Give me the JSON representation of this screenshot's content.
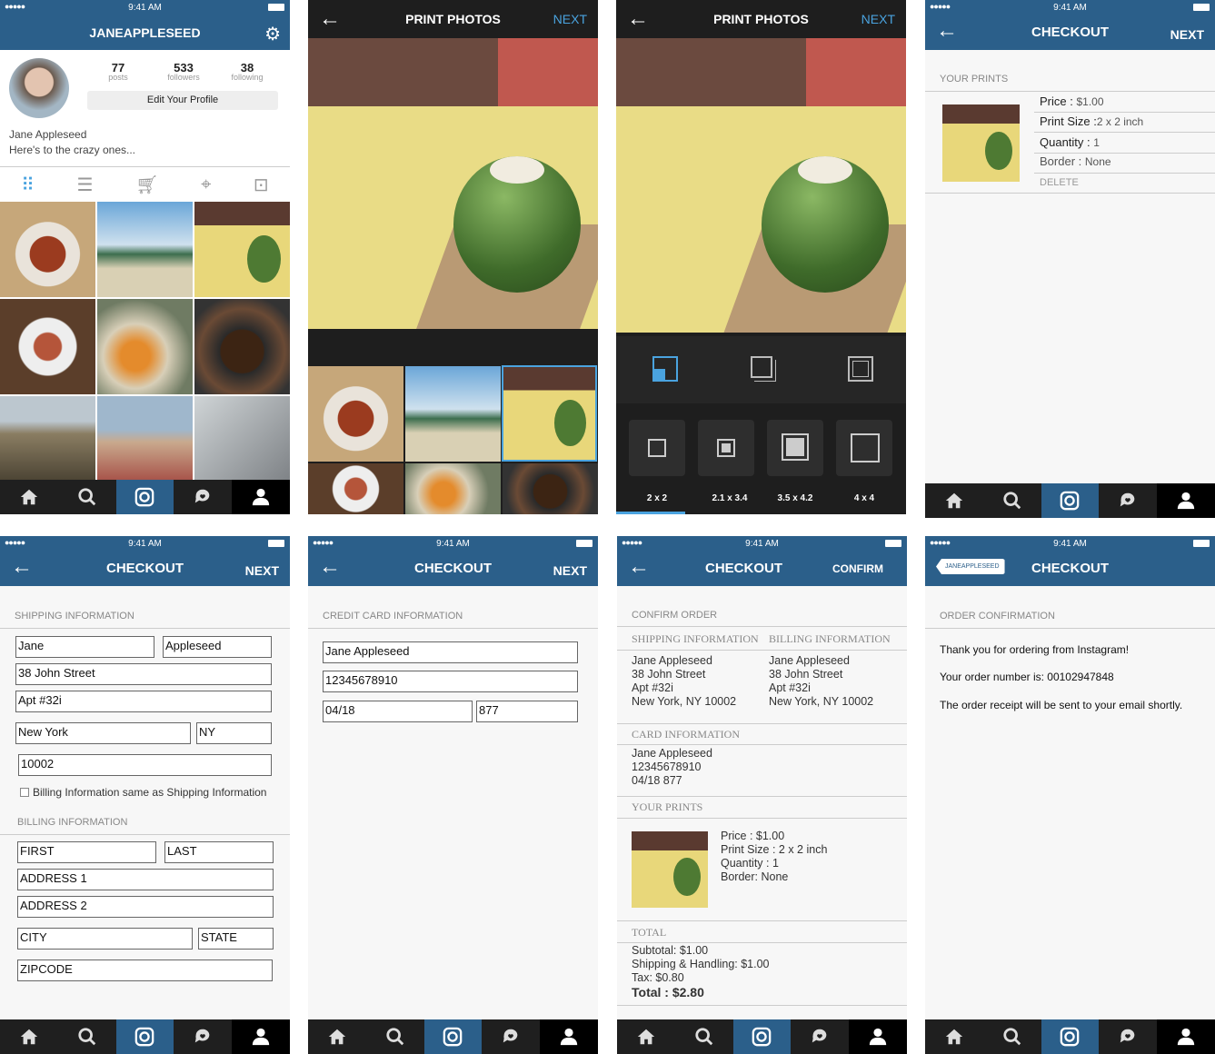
{
  "status": {
    "time": "9:41 AM"
  },
  "profile": {
    "username": "JANEAPPLESEED",
    "posts": "77",
    "posts_label": "posts",
    "followers": "533",
    "followers_label": "followers",
    "following": "38",
    "following_label": "following",
    "edit_button": "Edit Your Profile",
    "name": "Jane Appleseed",
    "bio": "Here's to the crazy ones..."
  },
  "print": {
    "title": "PRINT PHOTOS",
    "next": "NEXT",
    "sizes": [
      "2 x 2",
      "2.1 x 3.4",
      "3.5 x 4.2",
      "4 x 4"
    ]
  },
  "cart": {
    "title": "CHECKOUT",
    "next": "NEXT",
    "section": "YOUR PRINTS",
    "price_label": "Price :",
    "price": "$1.00",
    "size_label": "Print Size :",
    "size": "2 x 2 inch",
    "qty_label": "Quantity :",
    "qty": "1",
    "border_label": "Border :",
    "border": "None",
    "delete": "DELETE"
  },
  "shipping": {
    "title": "CHECKOUT",
    "next": "NEXT",
    "section": "SHIPPING INFORMATION",
    "first": "Jane",
    "last": "Appleseed",
    "address1": "38 John Street",
    "address2": "Apt #32i",
    "city": "New York",
    "state": "NY",
    "zip": "10002",
    "same_label": "Billing Information same as Shipping Information",
    "billing_section": "BILLING INFORMATION",
    "ph_first": "FIRST",
    "ph_last": "LAST",
    "ph_addr1": "ADDRESS 1",
    "ph_addr2": "ADDRESS 2",
    "ph_city": "CITY",
    "ph_state": "STATE",
    "ph_zip": "ZIPCODE"
  },
  "card": {
    "title": "CHECKOUT",
    "next": "NEXT",
    "section": "CREDIT CARD INFORMATION",
    "name": "Jane Appleseed",
    "number": "12345678910",
    "exp": "04/18",
    "cvv": "877"
  },
  "confirm": {
    "title": "CHECKOUT",
    "action": "CONFIRM",
    "section": "CONFIRM ORDER",
    "ship_hdr": "SHIPPING INFORMATION",
    "bill_hdr": "BILLING INFORMATION",
    "ship_lines": [
      "Jane Appleseed",
      "38 John Street",
      "Apt #32i",
      "New York,  NY 10002"
    ],
    "bill_lines": [
      "Jane Appleseed",
      "38 John Street",
      "Apt #32i",
      "New York,  NY 10002"
    ],
    "card_hdr": "CARD INFORMATION",
    "card_lines": [
      "Jane Appleseed",
      "12345678910",
      "04/18 877"
    ],
    "prints_hdr": "YOUR PRINTS",
    "print_lines": [
      "Price :  $1.00",
      "Print Size :  2 x 2 inch",
      "Quantity :  1",
      "Border:  None"
    ],
    "total_hdr": "TOTAL",
    "subtotal": "Subtotal:  $1.00",
    "shipping": "Shipping & Handling:  $1.00",
    "tax": "Tax:  $0.80",
    "total": "Total :  $2.80"
  },
  "done": {
    "badge": "JANEAPPLESEED",
    "title": "CHECKOUT",
    "section": "ORDER CONFIRMATION",
    "line1": "Thank you for ordering from Instagram!",
    "line2": "Your order number is: 00102947848",
    "line3": "The order receipt will be sent to your email shortly."
  }
}
